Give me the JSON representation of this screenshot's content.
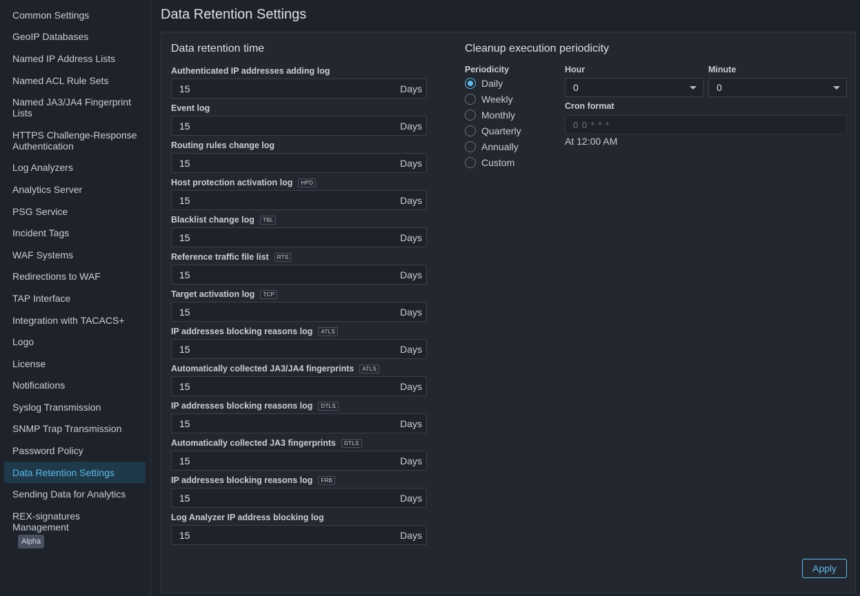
{
  "sidebar": {
    "items": [
      {
        "label": "Common Settings"
      },
      {
        "label": "GeoIP Databases"
      },
      {
        "label": "Named IP Address Lists"
      },
      {
        "label": "Named ACL Rule Sets"
      },
      {
        "label": "Named JA3/JA4 Fingerprint Lists"
      },
      {
        "label": "HTTPS Challenge-Response Authentication"
      },
      {
        "label": "Log Analyzers"
      },
      {
        "label": "Analytics Server"
      },
      {
        "label": "PSG Service"
      },
      {
        "label": "Incident Tags"
      },
      {
        "label": "WAF Systems"
      },
      {
        "label": "Redirections to WAF"
      },
      {
        "label": "TAP Interface"
      },
      {
        "label": "Integration with TACACS+"
      },
      {
        "label": "Logo"
      },
      {
        "label": "License"
      },
      {
        "label": "Notifications"
      },
      {
        "label": "Syslog Transmission"
      },
      {
        "label": "SNMP Trap Transmission"
      },
      {
        "label": "Password Policy"
      },
      {
        "label": "Data Retention Settings",
        "active": true
      },
      {
        "label": "Sending Data for Analytics"
      },
      {
        "label": "REX-signatures Management",
        "badge": "Alpha"
      }
    ]
  },
  "page": {
    "title": "Data Retention Settings"
  },
  "retention": {
    "title": "Data retention time",
    "unit": "Days",
    "fields": [
      {
        "label": "Authenticated IP addresses adding log",
        "tag": "",
        "value": "15"
      },
      {
        "label": "Event log",
        "tag": "",
        "value": "15"
      },
      {
        "label": "Routing rules change log",
        "tag": "",
        "value": "15"
      },
      {
        "label": "Host protection activation log",
        "tag": "HPD",
        "value": "15"
      },
      {
        "label": "Blacklist change log",
        "tag": "TBL",
        "value": "15"
      },
      {
        "label": "Reference traffic file list",
        "tag": "RTS",
        "value": "15"
      },
      {
        "label": "Target activation log",
        "tag": "TCP",
        "value": "15"
      },
      {
        "label": "IP addresses blocking reasons log",
        "tag": "ATLS",
        "value": "15"
      },
      {
        "label": "Automatically collected JA3/JA4 fingerprints",
        "tag": "ATLS",
        "value": "15"
      },
      {
        "label": "IP addresses blocking reasons log",
        "tag": "DTLS",
        "value": "15"
      },
      {
        "label": "Automatically collected JA3 fingerprints",
        "tag": "DTLS",
        "value": "15"
      },
      {
        "label": "IP addresses blocking reasons log",
        "tag": "FRB",
        "value": "15"
      },
      {
        "label": "Log Analyzer IP address blocking log",
        "tag": "",
        "value": "15"
      }
    ]
  },
  "cleanup": {
    "title": "Cleanup execution periodicity",
    "periodicity_label": "Periodicity",
    "options": [
      {
        "label": "Daily",
        "checked": true
      },
      {
        "label": "Weekly",
        "checked": false
      },
      {
        "label": "Monthly",
        "checked": false
      },
      {
        "label": "Quarterly",
        "checked": false
      },
      {
        "label": "Annually",
        "checked": false
      },
      {
        "label": "Custom",
        "checked": false
      }
    ],
    "hour_label": "Hour",
    "hour_value": "0",
    "minute_label": "Minute",
    "minute_value": "0",
    "cron_label": "Cron format",
    "cron_value": "0 0 * * *",
    "cron_human": "At 12:00 AM"
  },
  "actions": {
    "apply_label": "Apply"
  },
  "colors": {
    "accent": "#5fb8e8",
    "background": "#1e222a",
    "panel": "#23272f"
  }
}
